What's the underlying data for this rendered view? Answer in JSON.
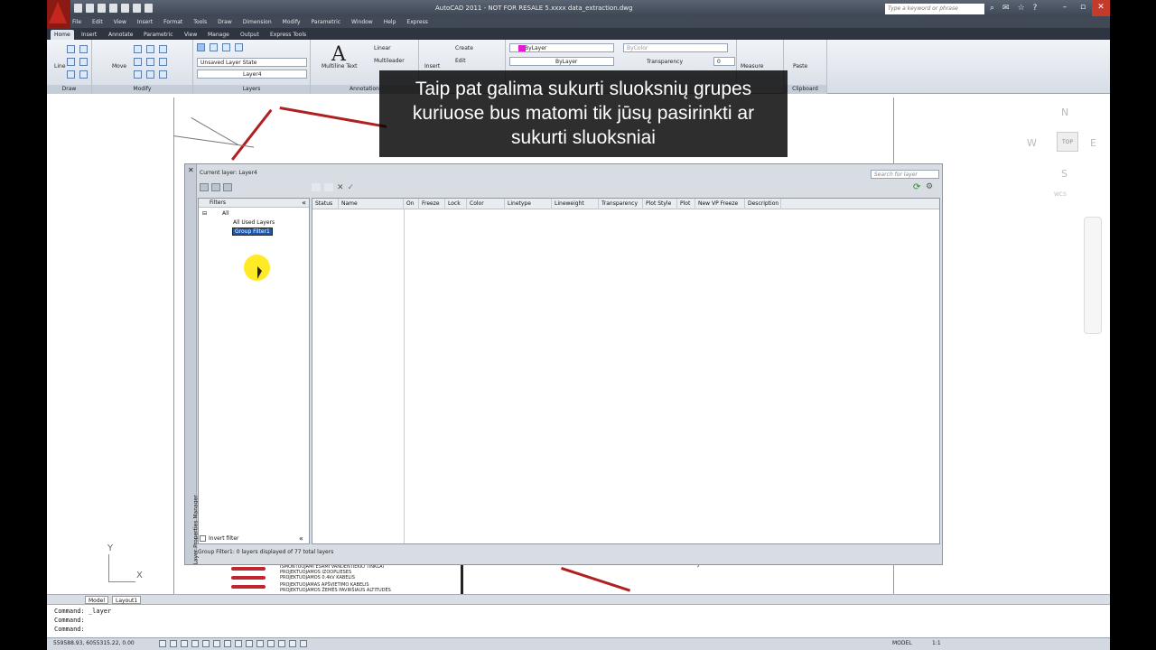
{
  "app": {
    "title": "AutoCAD 2011 - NOT FOR RESALE   5.xxxx data_extraction.dwg",
    "help_search_placeholder": "Type a keyword or phrase"
  },
  "menubar": [
    "File",
    "Edit",
    "View",
    "Insert",
    "Format",
    "Tools",
    "Draw",
    "Dimension",
    "Modify",
    "Parametric",
    "Window",
    "Help",
    "Express"
  ],
  "ribbon_tabs": [
    "Home",
    "Insert",
    "Annotate",
    "Parametric",
    "View",
    "Manage",
    "Output",
    "Express Tools"
  ],
  "ribbon": {
    "panels": [
      "Draw",
      "Modify",
      "Layers",
      "Annotation",
      "Clipboard"
    ],
    "buttons": {
      "line": "Line",
      "move": "Move",
      "multiline_text": "Multiline Text",
      "linear": "Linear",
      "multileader": "Multileader",
      "insert": "Insert",
      "create": "Create",
      "edit": "Edit",
      "measure": "Measure",
      "paste": "Paste"
    },
    "layer_state": "Unsaved Layer State",
    "current_layer_combo": "Layer4",
    "color_combo": "ByLayer",
    "linetype_combo": "ByLayer",
    "bycolor": "ByColor",
    "transparency_label": "Transparency",
    "transparency_value": "0"
  },
  "caption": {
    "lines": [
      "Taip pat galima sukurti sluoksnių grupes",
      "kuriuose bus matomi tik jūsų pasirinkti ar",
      "sukurti sluoksniai"
    ]
  },
  "viewcube": {
    "n": "N",
    "w": "W",
    "e": "E",
    "s": "S",
    "top": "TOP",
    "wcs": "WCS"
  },
  "layer_manager": {
    "current_layer": "Current layer: Layer4",
    "search_placeholder": "Search for layer",
    "side_title": "Layer Properties Manager",
    "filters_title": "Filters",
    "tree": {
      "all": "All",
      "all_used": "All Used Layers",
      "group_filter": "Group Filter1"
    },
    "invert_filter": "Invert filter",
    "columns": [
      "Status",
      "Name",
      "On",
      "Freeze",
      "Lock",
      "Color",
      "Linetype",
      "Lineweight",
      "Transparency",
      "Plot Style",
      "Plot",
      "New VP Freeze",
      "Description"
    ],
    "status": "Group Filter1: 0 layers displayed of 77 total layers"
  },
  "legend_lines": [
    "IŠMONTUOJAMI ESAMI VANDENTIEKIO TINKLAI",
    "PROJEKTUOJAMOS IZOOPLIESES",
    "PROJEKTUOJAMOS 0.4kV KABELIS",
    "PROJEKTUOJAMAS APŠVIETIMO KABELIS",
    "PROJEKTUOJAMOS ŽEMĖS PAVIRŠIAUS ALTITUDĖS"
  ],
  "ucs": {
    "y": "Y",
    "x": "X"
  },
  "layout_tabs": [
    "Model",
    "Layout1"
  ],
  "command_lines": [
    "Command: _layer",
    "Command:",
    "",
    "Command:"
  ],
  "statusbar": {
    "coords": "559588.93, 6055315.22, 0.00",
    "model": "MODEL",
    "scale": "1:1"
  },
  "colors": {
    "accent": "#1c57a8",
    "logo": "#c4271e",
    "magenta_layer": "#e21ad8",
    "cursor_highlight": "#ffe600"
  }
}
